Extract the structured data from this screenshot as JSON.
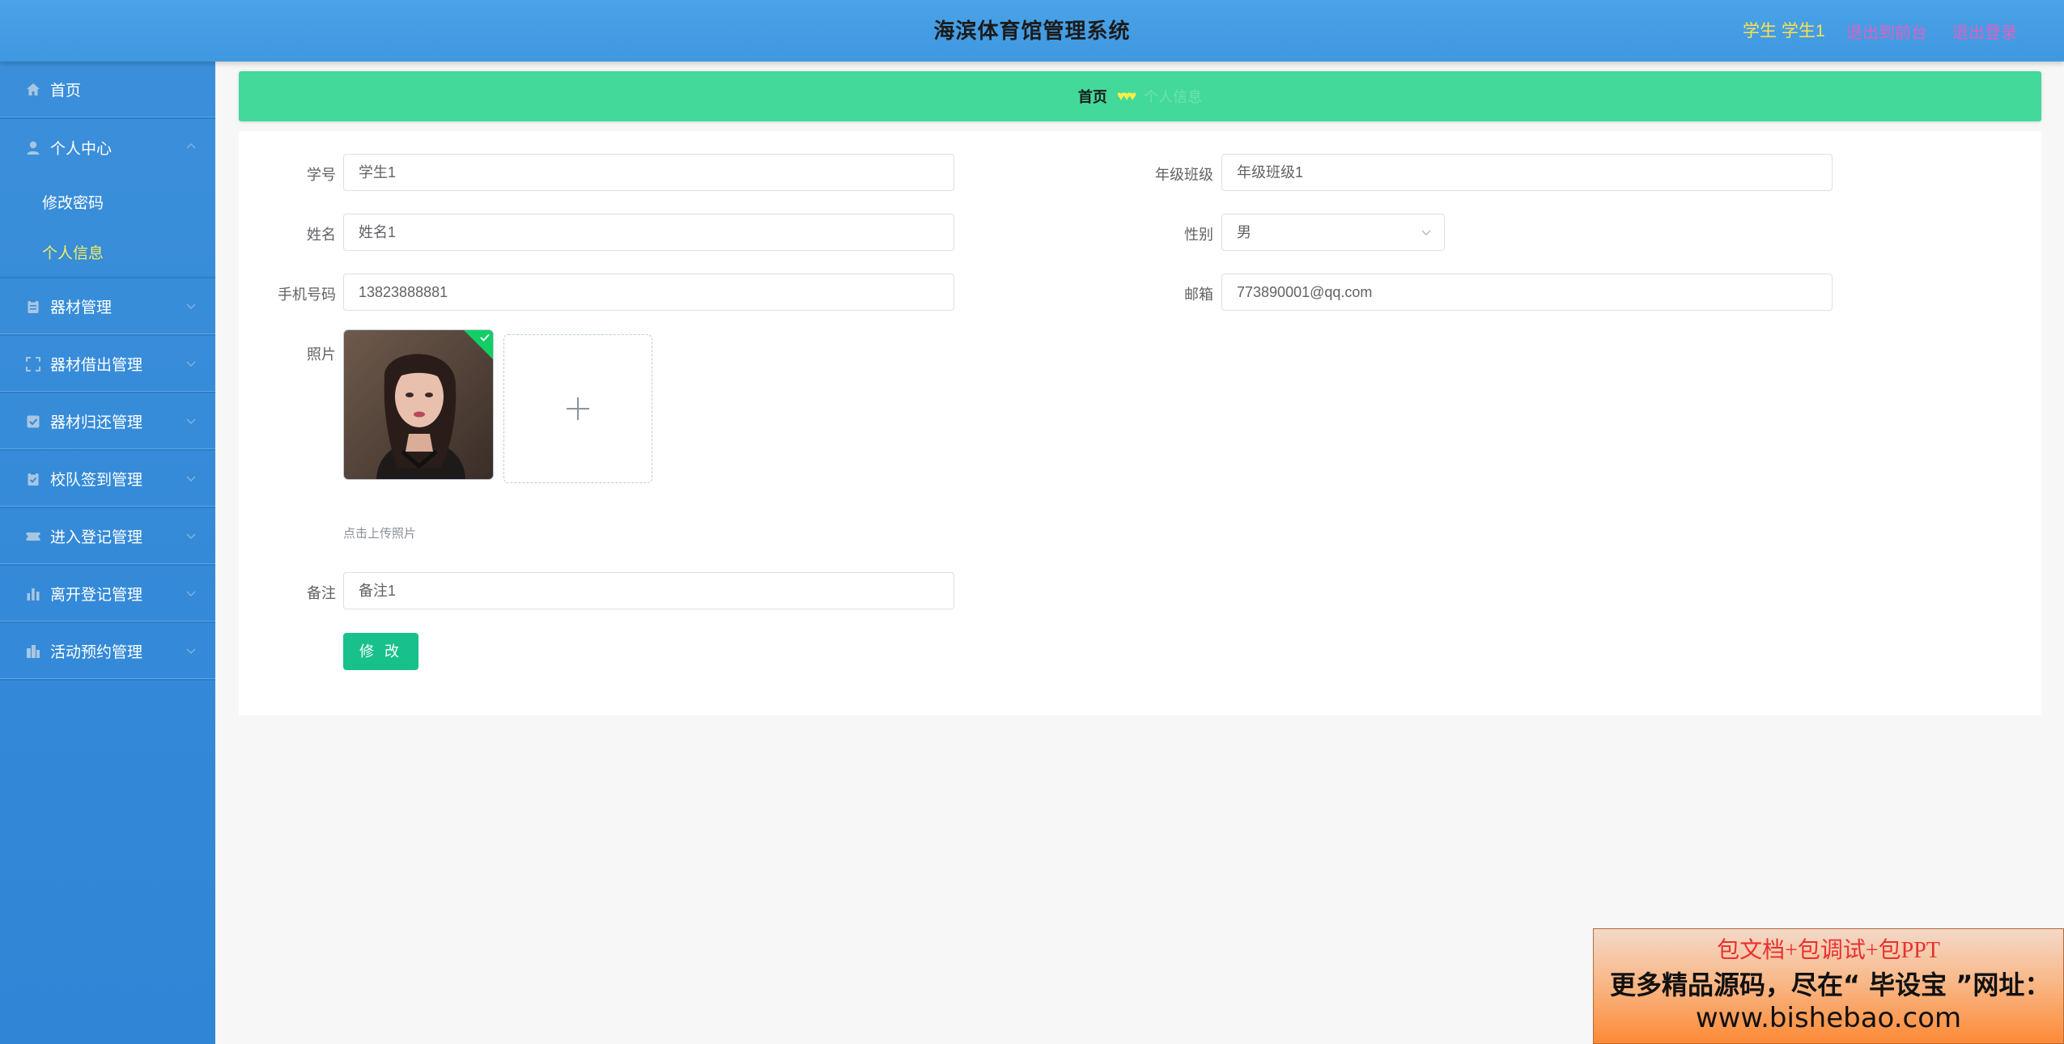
{
  "header": {
    "title": "海滨体育馆管理系统",
    "user": "学生 学生1",
    "back_to_front": "退出到前台",
    "logout": "退出登录"
  },
  "sidebar": {
    "items": [
      {
        "label": "首页",
        "icon": "home-icon"
      },
      {
        "label": "个人中心",
        "icon": "user-icon",
        "expanded": true,
        "children": [
          {
            "label": "修改密码",
            "active": false
          },
          {
            "label": "个人信息",
            "active": true
          }
        ]
      },
      {
        "label": "器材管理",
        "icon": "clipboard-icon"
      },
      {
        "label": "器材借出管理",
        "icon": "expand-icon"
      },
      {
        "label": "器材归还管理",
        "icon": "checkbox-icon"
      },
      {
        "label": "校队签到管理",
        "icon": "clipboard-check-icon"
      },
      {
        "label": "进入登记管理",
        "icon": "ticket-icon"
      },
      {
        "label": "离开登记管理",
        "icon": "bar-chart-icon"
      },
      {
        "label": "活动预约管理",
        "icon": "building-icon"
      }
    ]
  },
  "breadcrumb": {
    "home": "首页",
    "separator": "♥♥♥",
    "current": "个人信息"
  },
  "form": {
    "student_id": {
      "label": "学号",
      "value": "学生1"
    },
    "grade_class": {
      "label": "年级班级",
      "value": "年级班级1"
    },
    "name": {
      "label": "姓名",
      "value": "姓名1"
    },
    "gender": {
      "label": "性别",
      "value": "男"
    },
    "phone": {
      "label": "手机号码",
      "value": "13823888881"
    },
    "email": {
      "label": "邮箱",
      "value": "773890001@qq.com"
    },
    "photo": {
      "label": "照片",
      "hint": "点击上传照片"
    },
    "remark": {
      "label": "备注",
      "value": "备注1"
    },
    "submit_label": "修 改"
  },
  "ad": {
    "line1": "包文档+包调试+包PPT",
    "line2": "更多精品源码，尽在“ 毕设宝 ”网址：",
    "line3": "www.bishebao.com"
  },
  "colors": {
    "header": "#4aa3e8",
    "sidebar": "#3389d8",
    "breadcrumb": "#42d99a",
    "button": "#18c18b",
    "active_menu": "#f2ee62"
  }
}
